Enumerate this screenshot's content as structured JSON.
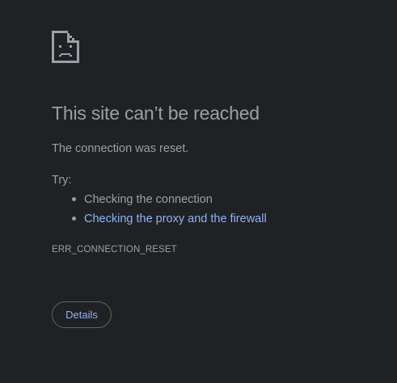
{
  "error_page": {
    "icon": "sad-page-icon",
    "title": "This site can’t be reached",
    "message": "The connection was reset.",
    "try_label": "Try:",
    "suggestions": [
      {
        "label": "Checking the connection",
        "is_link": false
      },
      {
        "label": "Checking the proxy and the firewall",
        "is_link": true
      }
    ],
    "error_code": "ERR_CONNECTION_RESET",
    "details_button_label": "Details"
  },
  "colors": {
    "background": "#202124",
    "text": "#9aa0a6",
    "link": "#8ab4f8",
    "button_border": "#5f6368"
  }
}
